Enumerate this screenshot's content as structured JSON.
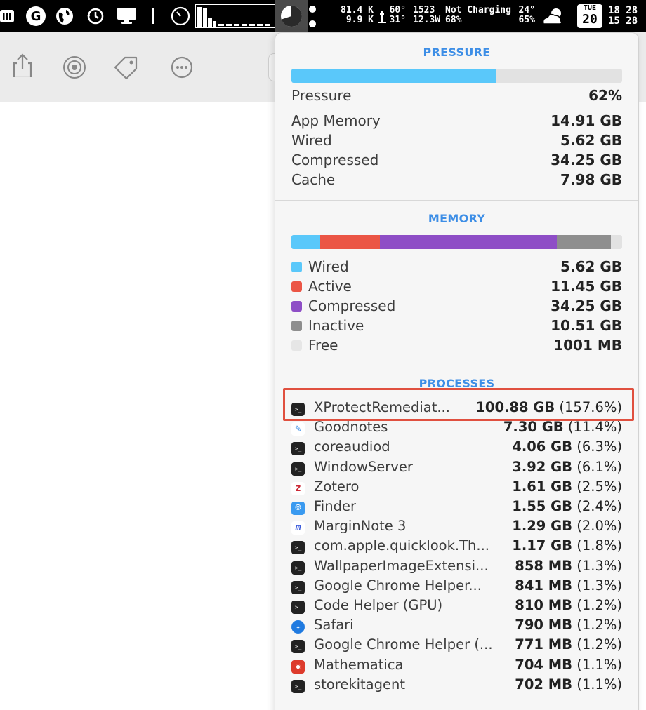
{
  "menubar": {
    "net_up": "81.4 K",
    "net_down": "9.9 K",
    "temp_cpu": "60°",
    "temp_low": "31°",
    "fan_rpm": "1523",
    "power": "12.3W",
    "battery_status": "Not Charging",
    "battery_pct": "68%",
    "weather_temp": "24°",
    "weather_humidity": "65%",
    "day_name": "TUE",
    "day_num": "20",
    "time_a": "18 28",
    "time_b": "15 28"
  },
  "pressure": {
    "title": "PRESSURE",
    "level_fraction": 0.62,
    "rows": [
      {
        "label": "Pressure",
        "value": "62%"
      },
      {
        "label": "App Memory",
        "value": "14.91 GB"
      },
      {
        "label": "Wired",
        "value": "5.62 GB"
      },
      {
        "label": "Compressed",
        "value": "34.25 GB"
      },
      {
        "label": "Cache",
        "value": "7.98 GB"
      }
    ]
  },
  "memory": {
    "title": "MEMORY",
    "legend": [
      {
        "label": "Wired",
        "value": "5.62 GB",
        "color": "#5ac8fa",
        "fraction": 0.088
      },
      {
        "label": "Active",
        "value": "11.45 GB",
        "color": "#eb5545",
        "fraction": 0.179
      },
      {
        "label": "Compressed",
        "value": "34.25 GB",
        "color": "#8e4ec6",
        "fraction": 0.535
      },
      {
        "label": "Inactive",
        "value": "10.51 GB",
        "color": "#8e8e8e",
        "fraction": 0.164
      },
      {
        "label": "Free",
        "value": "1001 MB",
        "color": "#e2e2e2",
        "fraction": 0.016
      }
    ]
  },
  "processes": {
    "title": "PROCESSES",
    "items": [
      {
        "name": "XProtectRemediat...",
        "size": "100.88 GB",
        "pct": "(157.6%)",
        "icon": "terminal-icon"
      },
      {
        "name": "Goodnotes",
        "size": "7.30 GB",
        "pct": "(11.4%)",
        "icon": "goodnotes-icon"
      },
      {
        "name": "coreaudiod",
        "size": "4.06 GB",
        "pct": "(6.3%)",
        "icon": "terminal-icon"
      },
      {
        "name": "WindowServer",
        "size": "3.92 GB",
        "pct": "(6.1%)",
        "icon": "terminal-icon"
      },
      {
        "name": "Zotero",
        "size": "1.61 GB",
        "pct": "(2.5%)",
        "icon": "zotero-icon"
      },
      {
        "name": "Finder",
        "size": "1.55 GB",
        "pct": "(2.4%)",
        "icon": "finder-icon"
      },
      {
        "name": "MarginNote 3",
        "size": "1.29 GB",
        "pct": "(2.0%)",
        "icon": "marginnote-icon"
      },
      {
        "name": "com.apple.quicklook.Th...",
        "size": "1.17 GB",
        "pct": "(1.8%)",
        "icon": "terminal-icon"
      },
      {
        "name": "WallpaperImageExtensi...",
        "size": "858 MB",
        "pct": "(1.3%)",
        "icon": "terminal-icon"
      },
      {
        "name": "Google Chrome Helper...",
        "size": "841 MB",
        "pct": "(1.3%)",
        "icon": "terminal-icon"
      },
      {
        "name": "Code Helper (GPU)",
        "size": "810 MB",
        "pct": "(1.2%)",
        "icon": "terminal-icon"
      },
      {
        "name": "Safari",
        "size": "790 MB",
        "pct": "(1.2%)",
        "icon": "safari-icon"
      },
      {
        "name": "Google Chrome Helper (...",
        "size": "771 MB",
        "pct": "(1.2%)",
        "icon": "terminal-icon"
      },
      {
        "name": "Mathematica",
        "size": "704 MB",
        "pct": "(1.1%)",
        "icon": "mathematica-icon"
      },
      {
        "name": "storekitagent",
        "size": "702 MB",
        "pct": "(1.1%)",
        "icon": "terminal-icon"
      }
    ]
  },
  "colors": {
    "accent": "#3d8ee6",
    "pressure_fill": "#5ac8fa",
    "highlight": "#e0503f"
  }
}
